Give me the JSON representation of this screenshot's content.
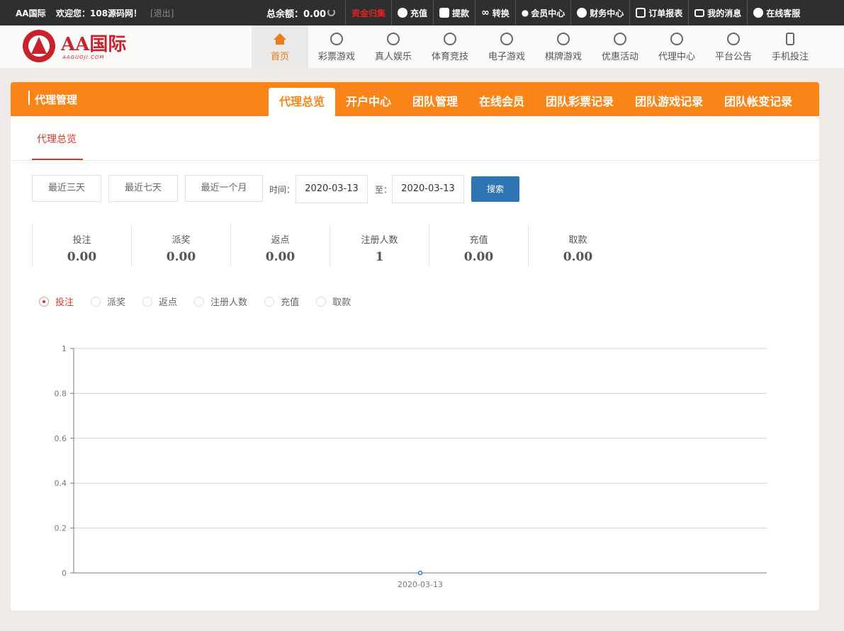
{
  "topbar": {
    "brand": "AA国际",
    "welcome": "欢迎您：108源码网！",
    "logout": "[退出]",
    "balance_label": "总余额：",
    "balance_value": "0.00",
    "links": [
      {
        "label": "资金归集",
        "icon": "collect-icon",
        "color": "#e02222"
      },
      {
        "label": "充值",
        "icon": "deposit-icon"
      },
      {
        "label": "提款",
        "icon": "wallet-icon"
      },
      {
        "label": "转换",
        "icon": "infinity-icon"
      },
      {
        "label": "会员中心",
        "icon": "user-icon"
      },
      {
        "label": "财务中心",
        "icon": "finance-icon"
      },
      {
        "label": "订单报表",
        "icon": "report-icon"
      },
      {
        "label": "我的消息",
        "icon": "mail-icon"
      },
      {
        "label": "在线客服",
        "icon": "headset-icon"
      }
    ]
  },
  "logo": {
    "text": "AA国际",
    "sub": "AAGUOJI.COM"
  },
  "nav": {
    "items": [
      {
        "label": "首页",
        "icon": "home-icon"
      },
      {
        "label": "彩票游戏",
        "icon": "lottery-icon"
      },
      {
        "label": "真人娱乐",
        "icon": "casino-icon"
      },
      {
        "label": "体育竞技",
        "icon": "soccer-icon"
      },
      {
        "label": "电子游戏",
        "icon": "slot-icon"
      },
      {
        "label": "棋牌游戏",
        "icon": "chess-icon"
      },
      {
        "label": "优惠活动",
        "icon": "gift-icon"
      },
      {
        "label": "代理中心",
        "icon": "medal-icon"
      },
      {
        "label": "平台公告",
        "icon": "notice-icon"
      },
      {
        "label": "手机投注",
        "icon": "mobile-icon"
      }
    ]
  },
  "panel": {
    "title": "代理管理",
    "tabs": [
      "代理总览",
      "开户中心",
      "团队管理",
      "在线会员",
      "团队彩票记录",
      "团队游戏记录",
      "团队帐变记录"
    ],
    "subtab": "代理总览"
  },
  "filters": {
    "quick": [
      "最近三天",
      "最近七天",
      "最近一个月"
    ],
    "time_label": "时间：",
    "to_label": "至：",
    "date_from": "2020-03-13",
    "date_to": "2020-03-13",
    "search": "搜索"
  },
  "stats": [
    {
      "label": "投注",
      "value": "0.00"
    },
    {
      "label": "派奖",
      "value": "0.00"
    },
    {
      "label": "返点",
      "value": "0.00"
    },
    {
      "label": "注册人数",
      "value": "1"
    },
    {
      "label": "充值",
      "value": "0.00"
    },
    {
      "label": "取款",
      "value": "0.00"
    }
  ],
  "series_options": [
    "投注",
    "派奖",
    "返点",
    "注册人数",
    "充值",
    "取款"
  ],
  "chart_data": {
    "type": "line",
    "x": [
      "2020-03-13"
    ],
    "series": [
      {
        "values": [
          0
        ]
      }
    ],
    "ylim": [
      0,
      1
    ],
    "yticks": [
      "0",
      "0.2",
      "0.4",
      "0.6",
      "0.8",
      "1"
    ],
    "grid": true,
    "colors": {
      "line": "#2e75b4"
    }
  }
}
